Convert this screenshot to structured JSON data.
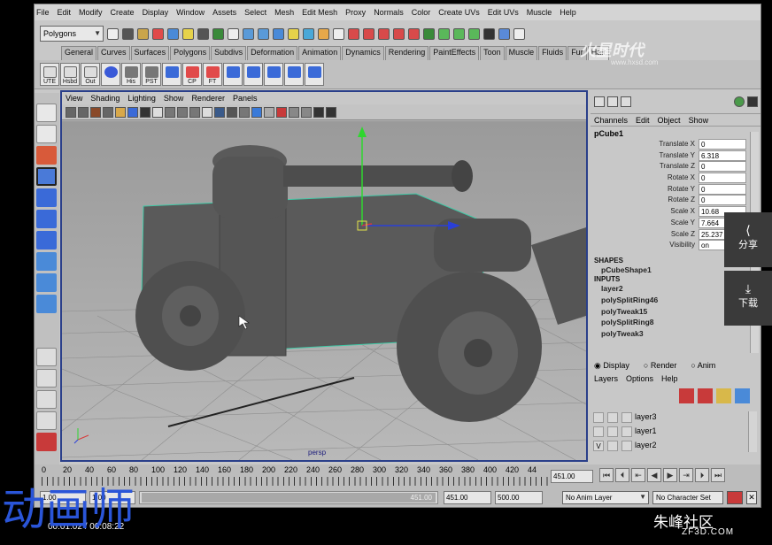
{
  "menubar": {
    "items": [
      "File",
      "Edit",
      "Modify",
      "Create",
      "Display",
      "Window",
      "Assets",
      "Select",
      "Mesh",
      "Edit Mesh",
      "Proxy",
      "Normals",
      "Color",
      "Create UVs",
      "Edit UVs",
      "Muscle",
      "Help"
    ]
  },
  "status": {
    "mode": "Polygons"
  },
  "shelf": {
    "tabs": [
      "General",
      "Curves",
      "Surfaces",
      "Polygons",
      "Subdivs",
      "Deformation",
      "Animation",
      "Dynamics",
      "Rendering",
      "PaintEffects",
      "Toon",
      "Muscle",
      "Fluids",
      "Fur",
      "Hair"
    ],
    "buttons": [
      "UTE",
      "Hsbd",
      "Out",
      "",
      "His",
      "PST",
      "",
      "CP",
      "FT",
      "",
      "",
      "",
      "",
      ""
    ]
  },
  "viewport": {
    "menu": [
      "View",
      "Shading",
      "Lighting",
      "Show",
      "Renderer",
      "Panels"
    ],
    "camera_label": "persp"
  },
  "channelbox": {
    "menu": [
      "Channels",
      "Edit",
      "Object",
      "Show"
    ],
    "object": "pCube1",
    "attrs": [
      {
        "name": "Translate X",
        "value": "0"
      },
      {
        "name": "Translate Y",
        "value": "6.318"
      },
      {
        "name": "Translate Z",
        "value": "0"
      },
      {
        "name": "Rotate X",
        "value": "0"
      },
      {
        "name": "Rotate Y",
        "value": "0"
      },
      {
        "name": "Rotate Z",
        "value": "0"
      },
      {
        "name": "Scale X",
        "value": "10.68"
      },
      {
        "name": "Scale Y",
        "value": "7.664"
      },
      {
        "name": "Scale Z",
        "value": "25.237"
      },
      {
        "name": "Visibility",
        "value": "on"
      }
    ],
    "shapes_label": "SHAPES",
    "shape": "pCubeShape1",
    "inputs_label": "INPUTS",
    "inputs": [
      "layer2",
      "polySplitRing46",
      "polyTweak15",
      "polySplitRing8",
      "polyTweak3"
    ]
  },
  "layers": {
    "tabs": [
      "Display",
      "Render",
      "Anim"
    ],
    "menu": [
      "Layers",
      "Options",
      "Help"
    ],
    "items": [
      {
        "name": "layer3",
        "v": ""
      },
      {
        "name": "layer1",
        "v": ""
      },
      {
        "name": "layer2",
        "v": "V"
      }
    ]
  },
  "timeline": {
    "ticks": [
      "0",
      "20",
      "40",
      "60",
      "80",
      "100",
      "120",
      "140",
      "160",
      "180",
      "200",
      "220",
      "240",
      "260",
      "280",
      "300",
      "320",
      "340",
      "360",
      "380",
      "400",
      "420",
      "44"
    ],
    "current": "451.00",
    "range_start": "1.00",
    "range_inner_start": "1.00",
    "range_inner_end": "451.00",
    "range_end": "451.00",
    "range_max": "500.00",
    "anim_layer": "No Anim Layer",
    "character_set": "No Character Set"
  },
  "side_panel": {
    "share": "分享",
    "download": "下载"
  },
  "overlay": {
    "logo_text": "动画师",
    "video_time": "00:01:02 / 00:08:22",
    "brand": "朱峰社区",
    "brand_url": "ZF3D.COM",
    "watermark": "火星时代",
    "watermark_url": "www.hxsd.com"
  }
}
